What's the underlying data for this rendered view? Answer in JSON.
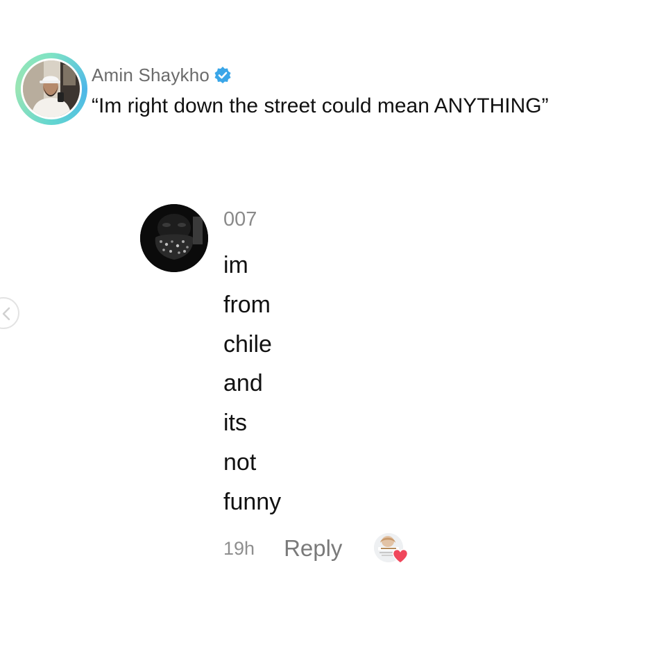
{
  "post": {
    "author": "Amin Shaykho",
    "verified": true,
    "text": "“Im right down the street could mean ANYTHING”",
    "avatar_ring_colors": [
      "#7fe3c4",
      "#4db7e8",
      "#9be5b4"
    ]
  },
  "comment": {
    "username": "007",
    "lines": [
      "im",
      "from",
      "chile",
      "and",
      "its",
      "not",
      "funny"
    ],
    "time": "19h",
    "reply_label": "Reply",
    "liked_by_creator": true
  },
  "colors": {
    "verified_badge": "#3aa6e8",
    "heart": "#f0475b",
    "secondary_text": "#8a8a8a"
  },
  "icons": {
    "verified": "verified-badge-icon",
    "heart": "heart-icon",
    "back": "chevron-left-icon"
  }
}
